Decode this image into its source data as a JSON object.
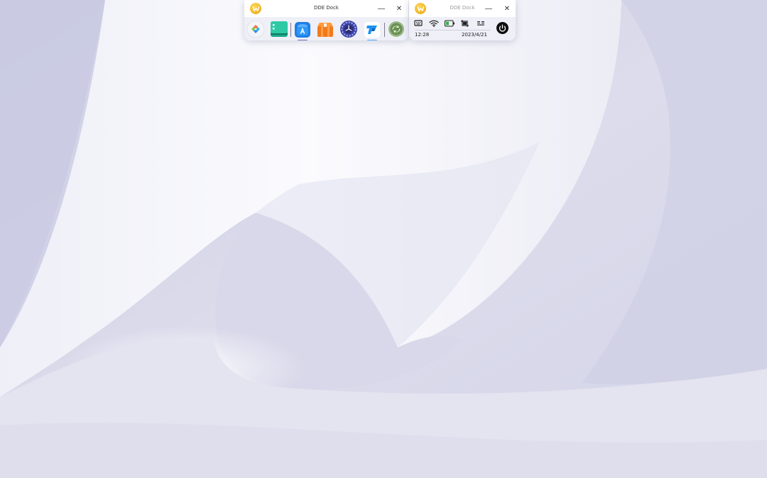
{
  "wallpaper": {
    "base_color": "#d6d7ea",
    "highlight_color": "#ffffff"
  },
  "dock_apps_window": {
    "title": "DDE Dock",
    "logo_icon": "deepin-w-logo",
    "minimize_glyph": "—",
    "close_glyph": "✕",
    "apps": [
      {
        "name": "launcher",
        "icon": "launcher-icon",
        "active": false
      },
      {
        "name": "terminal",
        "icon": "terminal-icon",
        "active": false
      },
      {
        "name": "app-store",
        "icon": "app-store-icon",
        "active": true
      },
      {
        "name": "package-installer",
        "icon": "package-icon",
        "active": false
      },
      {
        "name": "control-center",
        "icon": "control-center-icon",
        "active": false
      },
      {
        "name": "browser",
        "icon": "browser-icon",
        "active": true
      },
      {
        "name": "trash",
        "icon": "trash-icon",
        "active": false
      }
    ]
  },
  "dock_tray_window": {
    "title": "DDE Dock",
    "logo_icon": "deepin-w-logo",
    "minimize_glyph": "—",
    "close_glyph": "✕",
    "tray_icons": [
      "keyboard-icon",
      "wifi-icon",
      "battery-icon",
      "screenshot-icon",
      "input-method-icon"
    ],
    "battery_color": "#2fb24a",
    "time": "12:28",
    "date": "2023/4/21",
    "power_icon": "power-icon"
  }
}
